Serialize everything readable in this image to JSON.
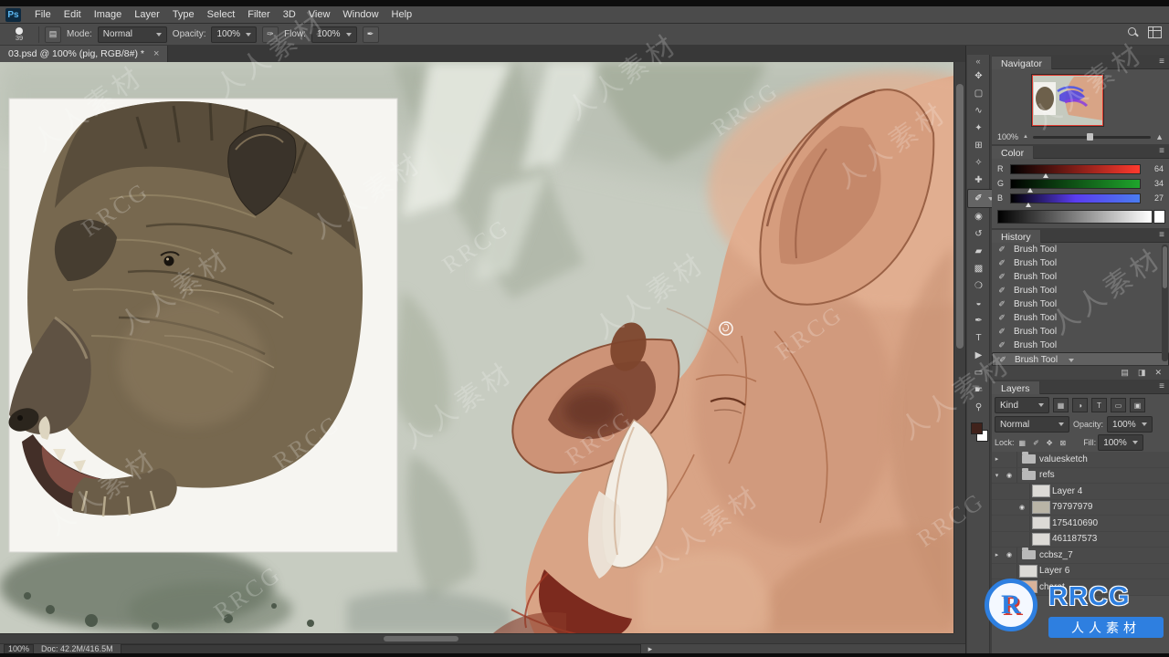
{
  "app": {
    "logo": "Ps"
  },
  "menubar": {
    "items": [
      "File",
      "Edit",
      "Image",
      "Layer",
      "Type",
      "Select",
      "Filter",
      "3D",
      "View",
      "Window",
      "Help"
    ]
  },
  "options": {
    "brush_size": "39",
    "mode_label": "Mode:",
    "mode_value": "Normal",
    "opacity_label": "Opacity:",
    "opacity_value": "100%",
    "flow_label": "Flow:",
    "flow_value": "100%"
  },
  "tab": {
    "title": "03.psd @ 100% (pig, RGB/8#) *"
  },
  "icons": {
    "close": "×",
    "panel_menu": "≡",
    "collapse_dock": "«",
    "history_state": "✐",
    "new_document": "▤",
    "new_snapshot": "◨",
    "delete_state": "✕",
    "status_arrow": "▸",
    "mountain": "▲",
    "lock_transparency": "▦",
    "lock_pixels": "✐",
    "lock_position": "✥",
    "lock_all": "⊠",
    "filter_pixel": "▦",
    "filter_adjustment": "◑",
    "filter_type": "T",
    "filter_shape": "▭",
    "filter_smart": "▣"
  },
  "tools": [
    {
      "name": "move",
      "glyph": "✥"
    },
    {
      "name": "rectangular-marquee",
      "glyph": "▢"
    },
    {
      "name": "lasso",
      "glyph": "∿"
    },
    {
      "name": "quick-selection",
      "glyph": "✦"
    },
    {
      "name": "crop",
      "glyph": "⊞"
    },
    {
      "name": "eyedropper",
      "glyph": "✧"
    },
    {
      "name": "spot-healing-brush",
      "glyph": "✚"
    },
    {
      "name": "brush",
      "glyph": "✐"
    },
    {
      "name": "clone-stamp",
      "glyph": "◉"
    },
    {
      "name": "history-brush",
      "glyph": "↺"
    },
    {
      "name": "eraser",
      "glyph": "▰"
    },
    {
      "name": "gradient",
      "glyph": "▩"
    },
    {
      "name": "blur",
      "glyph": "❍"
    },
    {
      "name": "dodge",
      "glyph": "◒"
    },
    {
      "name": "pen",
      "glyph": "✒"
    },
    {
      "name": "type",
      "glyph": "T"
    },
    {
      "name": "path-selection",
      "glyph": "▶"
    },
    {
      "name": "rectangle-shape",
      "glyph": "▭"
    },
    {
      "name": "hand",
      "glyph": "☛"
    },
    {
      "name": "zoom",
      "glyph": "⚲"
    }
  ],
  "toolbar_colors": {
    "foreground": "#40221b",
    "background": "#ffffff"
  },
  "navigator": {
    "title": "Navigator",
    "zoom": "100%"
  },
  "color_panel": {
    "title": "Color",
    "channels": [
      {
        "label": "R",
        "value": "64"
      },
      {
        "label": "G",
        "value": "34"
      },
      {
        "label": "B",
        "value": "27"
      }
    ]
  },
  "history": {
    "title": "History",
    "entries": [
      "Brush Tool",
      "Brush Tool",
      "Brush Tool",
      "Brush Tool",
      "Brush Tool",
      "Brush Tool",
      "Brush Tool",
      "Brush Tool",
      "Brush Tool"
    ]
  },
  "layers_panel": {
    "title": "Layers",
    "kind_label": "Kind",
    "blend_mode": "Normal",
    "opacity_label": "Opacity:",
    "opacity_value": "100%",
    "lock_label": "Lock:",
    "fill_label": "Fill:",
    "fill_value": "100%",
    "items": [
      {
        "name": "valuesketch",
        "eye": "",
        "twirl": "▸"
      },
      {
        "name": "refs",
        "eye": "◉",
        "twirl": "▾"
      },
      {
        "name": "Layer 4",
        "eye": ""
      },
      {
        "name": "79797979",
        "eye": "◉"
      },
      {
        "name": "175410690",
        "eye": ""
      },
      {
        "name": "461187573",
        "eye": ""
      },
      {
        "name": "ccbsz_7",
        "eye": "◉",
        "twirl": "▸"
      },
      {
        "name": "Layer 6",
        "eye": ""
      },
      {
        "name": "charat",
        "eye": "◉"
      }
    ]
  },
  "statusbar": {
    "zoom": "100%",
    "doc_info": "Doc: 42.2M/416.5M"
  },
  "watermark": {
    "cn": "人人素材",
    "en": "RRCG"
  },
  "brand": {
    "letter": "R",
    "name": "RRCG",
    "cn": "人人素材"
  }
}
